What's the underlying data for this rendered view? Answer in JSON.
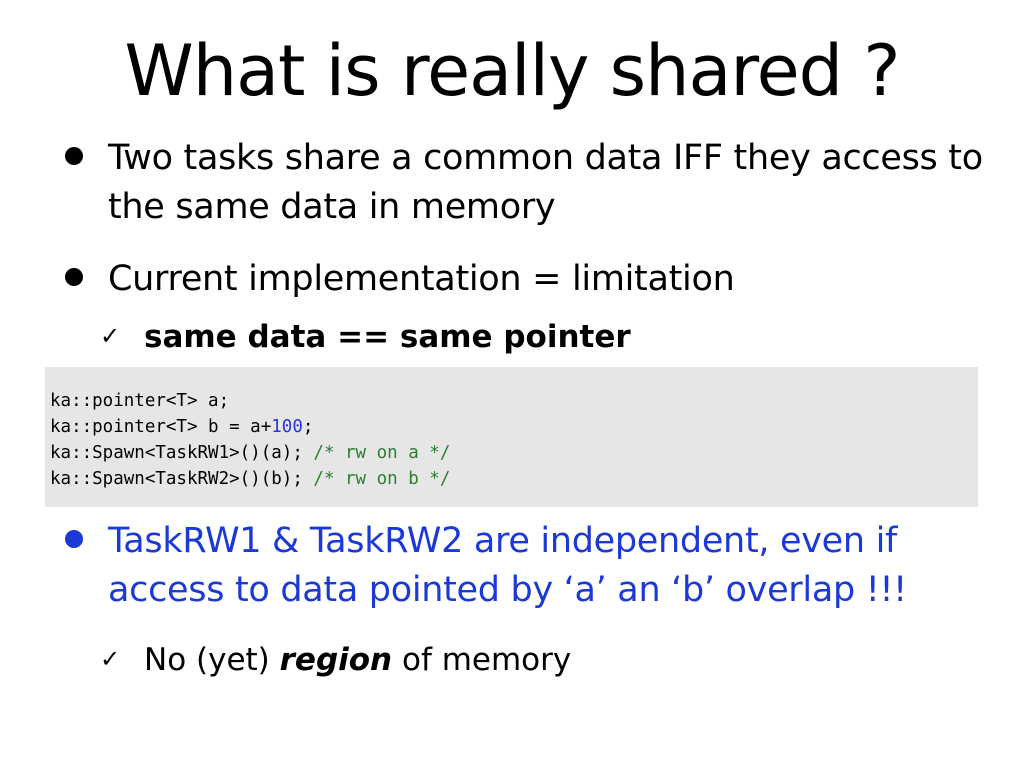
{
  "slide": {
    "title": "What is really shared ?",
    "bullets": [
      {
        "line1": "Two tasks share a common data IFF they access to",
        "line2": "the same data in memory"
      },
      {
        "line1": "Current implementation = limitation",
        "sub": "same data == same pointer"
      },
      {
        "line1": "TaskRW1 & TaskRW2 are independent, even if",
        "line2": "access to data pointed by ‘a’ an ‘b’ overlap !!!",
        "sub_prefix": "No (yet) ",
        "sub_emphasis": "region",
        "sub_suffix": " of memory"
      }
    ],
    "check_glyph": "✓",
    "code": {
      "line1": "ka::pointer<T> a;",
      "line2_prefix": "ka::pointer<T> b = a+",
      "line2_number": "100",
      "line2_suffix": ";",
      "line3_code": "ka::Spawn<TaskRW1>()(a); ",
      "line3_comment": "/* rw on a */",
      "line4_code": "ka::Spawn<TaskRW2>()(b); ",
      "line4_comment": "/* rw on b */"
    },
    "colors": {
      "blue_text": "#1b39d6",
      "code_comment": "#2e7d32",
      "code_number": "#2a36d6",
      "code_background": "#e6e6e6"
    }
  }
}
